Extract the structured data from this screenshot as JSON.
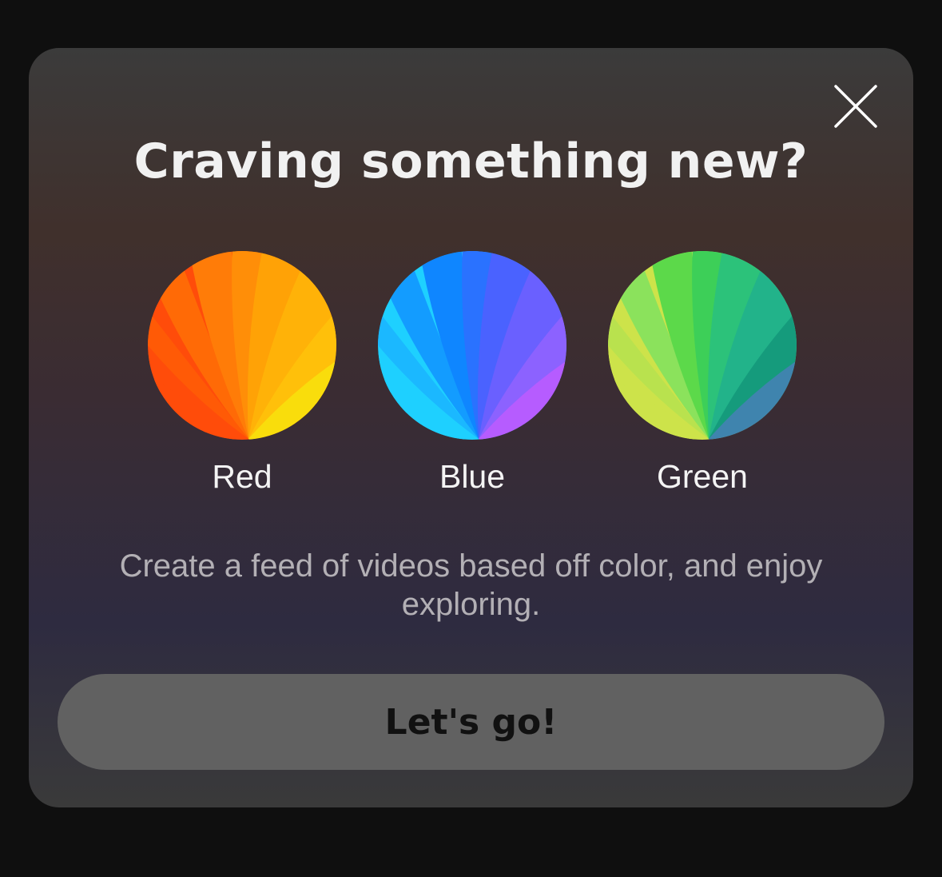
{
  "modal": {
    "title": "Craving something new?",
    "close_icon": "close-icon",
    "swatches": [
      {
        "label": "Red",
        "icon": "red-fan-icon",
        "colors": [
          "#ff4c0a",
          "#ff5a06",
          "#ff6a06",
          "#ff7c08",
          "#ff8e08",
          "#ffa206",
          "#ffb208",
          "#ffc00a",
          "#f9dd0c"
        ]
      },
      {
        "label": "Blue",
        "icon": "blue-fan-icon",
        "colors": [
          "#1ed0ff",
          "#1bb8ff",
          "#139cff",
          "#0f86ff",
          "#2a72ff",
          "#4a62ff",
          "#6a60ff",
          "#8c62ff",
          "#b65cff"
        ]
      },
      {
        "label": "Green",
        "icon": "green-fan-icon",
        "colors": [
          "#cde34a",
          "#b9e24e",
          "#8be25c",
          "#5cd94a",
          "#3dcf58",
          "#2cc27a",
          "#22b38a",
          "#159b7c",
          "#3f84ae"
        ]
      }
    ],
    "description": "Create a feed of videos based off color, and enjoy exploring.",
    "cta_label": "Let's go!"
  }
}
